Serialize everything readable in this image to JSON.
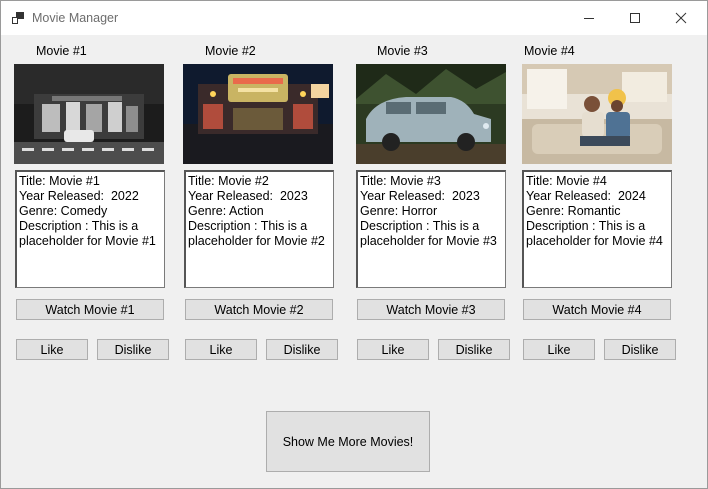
{
  "window": {
    "title": "Movie Manager"
  },
  "movies": [
    {
      "label": "Movie #1",
      "description": "Title: Movie #1\nYear Released:  2022\nGenre: Comedy\nDescription : This is a placeholder for Movie #1",
      "watch": "Watch Movie #1",
      "like": "Like",
      "dislike": "Dislike"
    },
    {
      "label": "Movie #2",
      "description": "Title: Movie #2\nYear Released:  2023\nGenre: Action\nDescription : This is a placeholder for Movie #2",
      "watch": "Watch Movie #2",
      "like": "Like",
      "dislike": "Dislike"
    },
    {
      "label": "Movie #3",
      "description": "Title: Movie #3\nYear Released:  2023\nGenre: Horror\nDescription : This is a placeholder for Movie #3",
      "watch": "Watch Movie #3",
      "like": "Like",
      "dislike": "Dislike"
    },
    {
      "label": "Movie #4",
      "description": "Title: Movie #4\nYear Released:  2024\nGenre: Romantic\nDescription : This is a placeholder for Movie #4",
      "watch": "Watch Movie #4",
      "like": "Like",
      "dislike": "Dislike"
    }
  ],
  "more_button": "Show Me More Movies!",
  "icons": {
    "app": "app-icon",
    "minimize": "minimize-icon",
    "maximize": "maximize-icon",
    "close": "close-icon"
  }
}
